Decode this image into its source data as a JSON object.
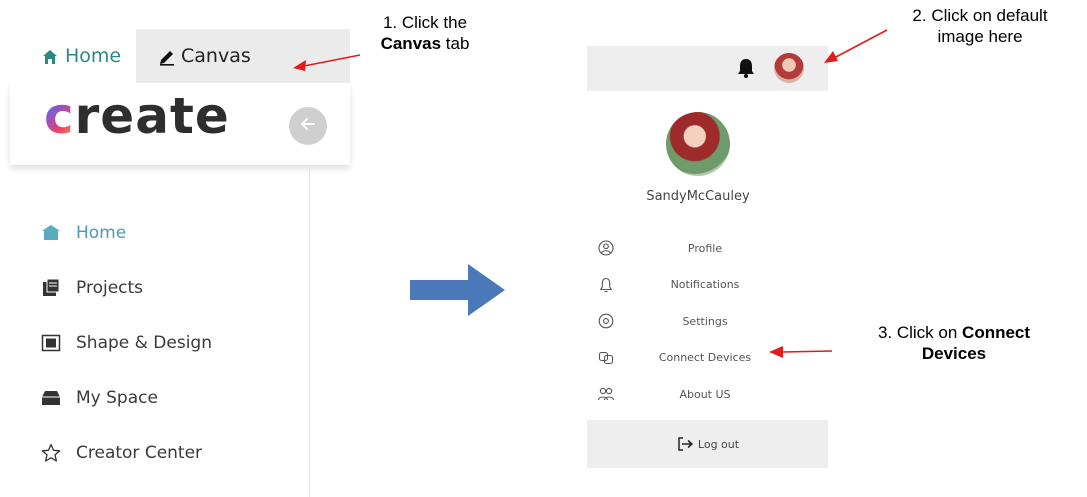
{
  "left": {
    "tabs": [
      {
        "label": "Home",
        "icon": "home-icon",
        "active": true
      },
      {
        "label": "Canvas",
        "icon": "pencil-icon",
        "active": false
      }
    ],
    "logo_rest": "reate",
    "logo_first": "c",
    "nav": [
      {
        "label": "Home",
        "icon": "home-icon",
        "active": true
      },
      {
        "label": "Projects",
        "icon": "projects-icon"
      },
      {
        "label": "Shape & Design",
        "icon": "shape-design-icon"
      },
      {
        "label": "My Space",
        "icon": "my-space-icon"
      },
      {
        "label": "Creator Center",
        "icon": "star-icon"
      }
    ]
  },
  "annotations": {
    "note1_line1": "1. Click the",
    "note1_bold": "Canvas",
    "note1_tail": " tab",
    "note2_line1": "2. Click on default",
    "note2_line2": "image here",
    "note3_line1": "3. Click on ",
    "note3_bold1": "Connect",
    "note3_bold2": "Devices"
  },
  "menu": {
    "username": "SandyMcCauley",
    "items": [
      {
        "label": "Profile",
        "icon": "profile-icon"
      },
      {
        "label": "Notifications",
        "icon": "bell-icon"
      },
      {
        "label": "Settings",
        "icon": "settings-icon"
      },
      {
        "label": "Connect Devices",
        "icon": "connect-devices-icon"
      },
      {
        "label": "About US",
        "icon": "about-us-icon"
      }
    ],
    "logout": "Log out"
  },
  "colors": {
    "accent_teal": "#2a8a82",
    "nav_active": "#4d9bb0",
    "annotation_red": "#e21b1b",
    "flow_arrow_blue": "#4a78b8"
  }
}
